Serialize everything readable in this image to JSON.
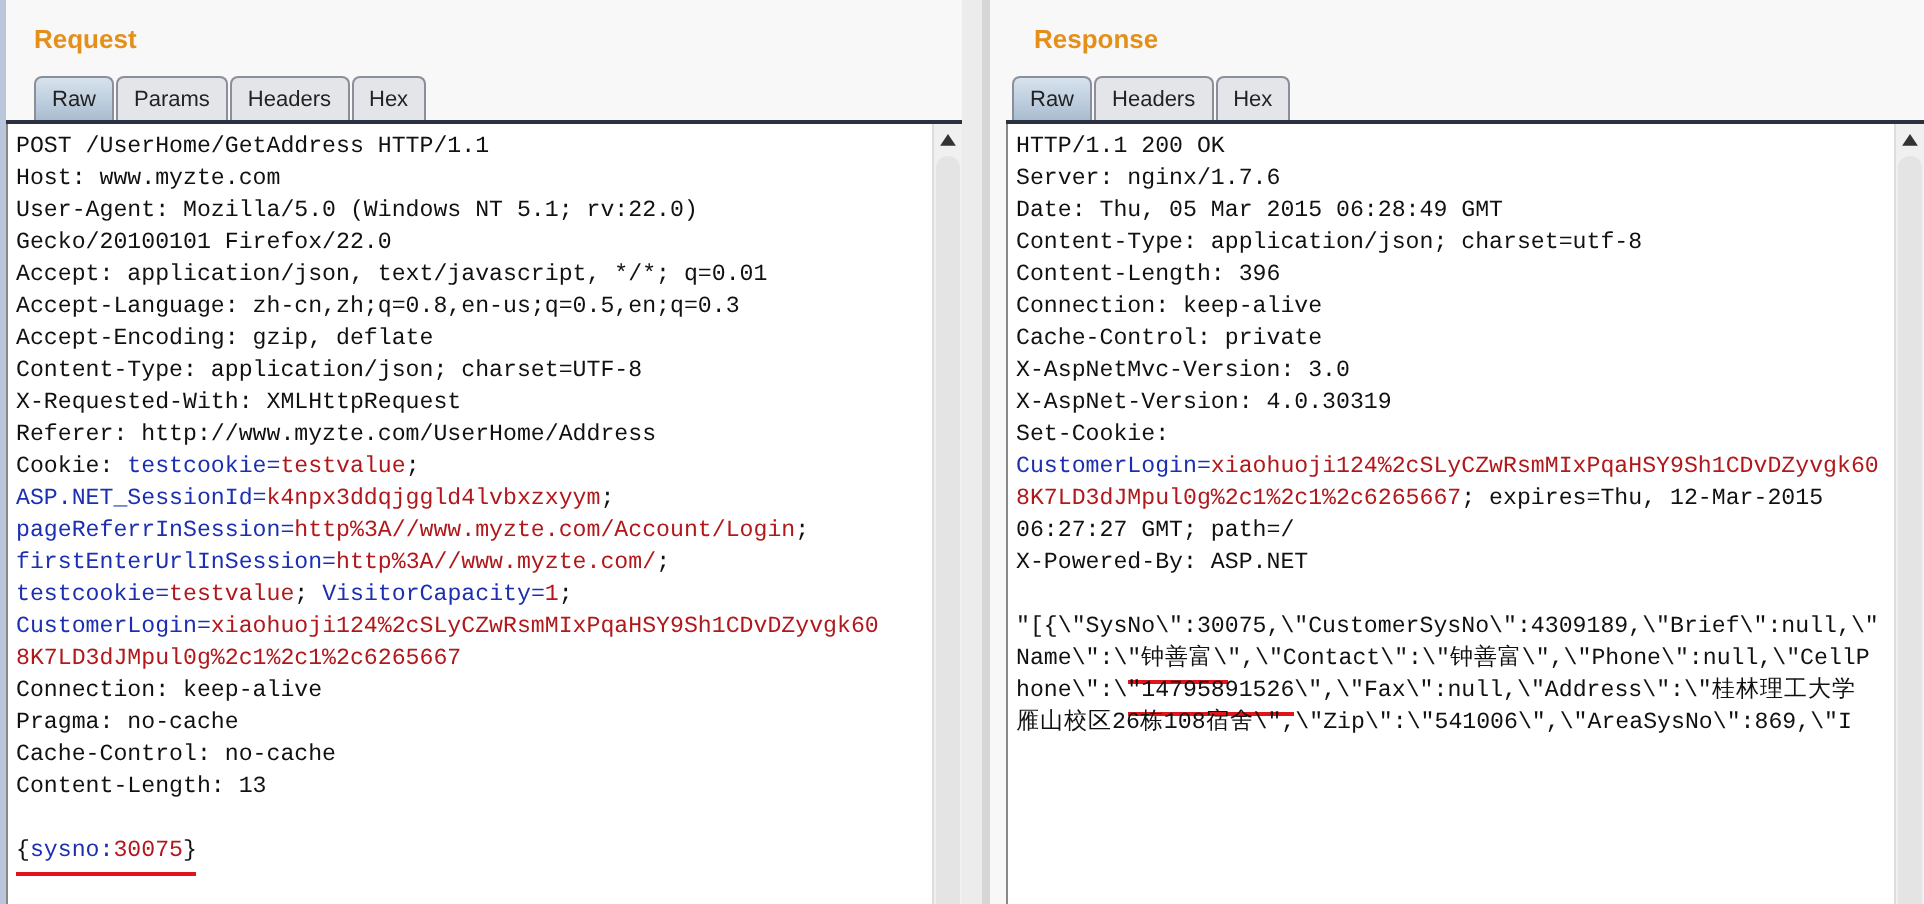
{
  "panels": [
    {
      "title": "Request",
      "tabs": [
        {
          "label": "Raw",
          "selected": true
        },
        {
          "label": "Params",
          "selected": false
        },
        {
          "label": "Headers",
          "selected": false
        },
        {
          "label": "Hex",
          "selected": false
        }
      ],
      "lines": [
        [
          {
            "text": "POST /UserHome/GetAddress HTTP/1.1",
            "kind": "plain"
          }
        ],
        [
          {
            "text": "Host: www.myzte.com",
            "kind": "plain"
          }
        ],
        [
          {
            "text": "User-Agent: Mozilla/5.0 (Windows NT 5.1; rv:22.0)",
            "kind": "plain"
          }
        ],
        [
          {
            "text": "Gecko/20100101 Firefox/22.0",
            "kind": "plain"
          }
        ],
        [
          {
            "text": "Accept: application/json, text/javascript, */*; q=0.01",
            "kind": "plain"
          }
        ],
        [
          {
            "text": "Accept-Language: zh-cn,zh;q=0.8,en-us;q=0.5,en;q=0.3",
            "kind": "plain"
          }
        ],
        [
          {
            "text": "Accept-Encoding: gzip, deflate",
            "kind": "plain"
          }
        ],
        [
          {
            "text": "Content-Type: application/json; charset=UTF-8",
            "kind": "plain"
          }
        ],
        [
          {
            "text": "X-Requested-With: XMLHttpRequest",
            "kind": "plain"
          }
        ],
        [
          {
            "text": "Referer: http://www.myzte.com/UserHome/Address",
            "kind": "plain"
          }
        ],
        [
          {
            "text": "Cookie: ",
            "kind": "plain"
          },
          {
            "text": "testcookie=",
            "kind": "name"
          },
          {
            "text": "testvalue",
            "kind": "value"
          },
          {
            "text": ";",
            "kind": "plain"
          }
        ],
        [
          {
            "text": "ASP.NET_SessionId=",
            "kind": "name"
          },
          {
            "text": "k4npx3ddqjggld4lvbxzxyym",
            "kind": "value"
          },
          {
            "text": ";",
            "kind": "plain"
          }
        ],
        [
          {
            "text": "pageReferrInSession=",
            "kind": "name"
          },
          {
            "text": "http%3A//www.myzte.com/Account/Login",
            "kind": "value"
          },
          {
            "text": ";",
            "kind": "plain"
          }
        ],
        [
          {
            "text": "firstEnterUrlInSession=",
            "kind": "name"
          },
          {
            "text": "http%3A//www.myzte.com/",
            "kind": "value"
          },
          {
            "text": ";",
            "kind": "plain"
          }
        ],
        [
          {
            "text": "testcookie=",
            "kind": "name"
          },
          {
            "text": "testvalue",
            "kind": "value"
          },
          {
            "text": "; ",
            "kind": "plain"
          },
          {
            "text": "VisitorCapacity=",
            "kind": "name"
          },
          {
            "text": "1",
            "kind": "value"
          },
          {
            "text": ";",
            "kind": "plain"
          }
        ],
        [
          {
            "text": "CustomerLogin=",
            "kind": "name"
          },
          {
            "text": "xiaohuoji124%2cSLyCZwRsmMIxPqaHSY9Sh1CDvDZyvgk60",
            "kind": "value"
          }
        ],
        [
          {
            "text": "8K7LD3dJMpul0g%2c1%2c1%2c6265667",
            "kind": "value"
          }
        ],
        [
          {
            "text": "Connection: keep-alive",
            "kind": "plain"
          }
        ],
        [
          {
            "text": "Pragma: no-cache",
            "kind": "plain"
          }
        ],
        [
          {
            "text": "Cache-Control: no-cache",
            "kind": "plain"
          }
        ],
        [
          {
            "text": "Content-Length: 13",
            "kind": "plain"
          }
        ],
        [
          {
            "text": "{",
            "kind": "plain",
            "underlined": true,
            "blank_line_before": true
          },
          {
            "text": "sysno:",
            "kind": "name",
            "underlined": true
          },
          {
            "text": "30075",
            "kind": "value",
            "underlined": true
          },
          {
            "text": "}",
            "kind": "plain",
            "underlined": true
          }
        ]
      ]
    },
    {
      "title": "Response",
      "tabs": [
        {
          "label": "Raw",
          "selected": true
        },
        {
          "label": "Headers",
          "selected": false
        },
        {
          "label": "Hex",
          "selected": false
        }
      ],
      "lines": [
        [
          {
            "text": "HTTP/1.1 200 OK",
            "kind": "plain"
          }
        ],
        [
          {
            "text": "Server: nginx/1.7.6",
            "kind": "plain"
          }
        ],
        [
          {
            "text": "Date: Thu, 05 Mar 2015 06:28:49 GMT",
            "kind": "plain"
          }
        ],
        [
          {
            "text": "Content-Type: application/json; charset=utf-8",
            "kind": "plain"
          }
        ],
        [
          {
            "text": "Content-Length: 396",
            "kind": "plain"
          }
        ],
        [
          {
            "text": "Connection: keep-alive",
            "kind": "plain"
          }
        ],
        [
          {
            "text": "Cache-Control: private",
            "kind": "plain"
          }
        ],
        [
          {
            "text": "X-AspNetMvc-Version: 3.0",
            "kind": "plain"
          }
        ],
        [
          {
            "text": "X-AspNet-Version: 4.0.30319",
            "kind": "plain"
          }
        ],
        [
          {
            "text": "Set-Cookie:",
            "kind": "plain"
          }
        ],
        [
          {
            "text": "CustomerLogin=",
            "kind": "name"
          },
          {
            "text": "xiaohuoji124%2cSLyCZwRsmMIxPqaHSY9Sh1CDvDZyvgk60",
            "kind": "value"
          }
        ],
        [
          {
            "text": "8K7LD3dJMpul0g%2c1%2c1%2c6265667",
            "kind": "value"
          },
          {
            "text": "; expires=Thu, 12-Mar-2015",
            "kind": "plain"
          }
        ],
        [
          {
            "text": "06:27:27 GMT; path=/",
            "kind": "plain"
          }
        ],
        [
          {
            "text": "X-Powered-By: ASP.NET",
            "kind": "plain"
          }
        ],
        [
          {
            "blank_line_before": true,
            "text": "\"[{\\\"SysNo\\\":30075,\\\"CustomerSysNo\\\":4309189,\\\"Brief\\\":null,\\\"",
            "kind": "plain"
          }
        ],
        [
          {
            "text": "Name\\\":\\",
            "kind": "plain"
          },
          {
            "text": "\"钟善富\\",
            "kind": "plain",
            "underlined": true
          },
          {
            "text": "\",\\\"Contact\\\":\\\"钟善富\\\",\\\"Phone\\\":null,\\\"CellP",
            "kind": "plain"
          }
        ],
        [
          {
            "text": "hone\\\":\\",
            "kind": "plain"
          },
          {
            "text": "\"14795891526",
            "kind": "plain",
            "underlined": true
          },
          {
            "text": "\\\",\\\"Fax\\\":null,\\\"Address\\\":\\\"桂林理工大学",
            "kind": "plain"
          }
        ],
        [
          {
            "text": "雁山校区26栋108宿舍\\\",\\\"Zip\\\":\\\"541006\\\",\\\"AreaSysNo\\\":869,\\\"I",
            "kind": "plain"
          }
        ]
      ]
    }
  ]
}
